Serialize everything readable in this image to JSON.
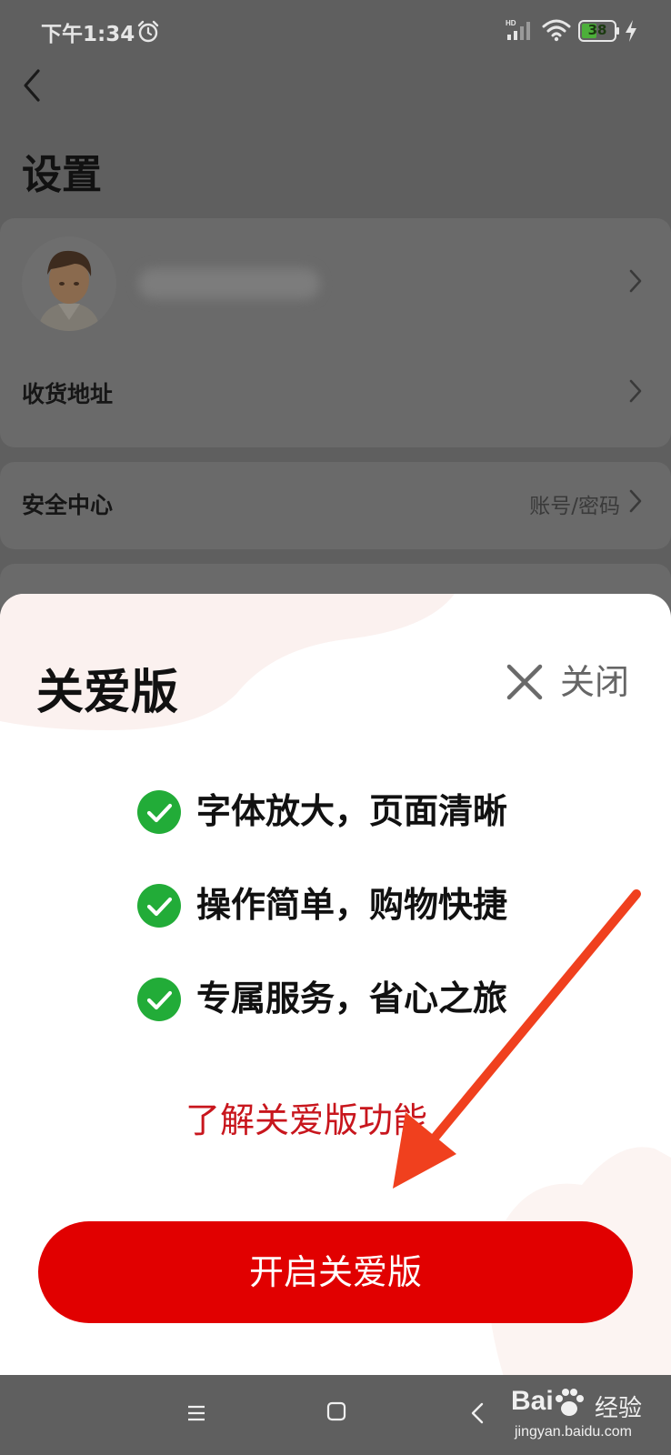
{
  "status_bar": {
    "time": "下午1:34",
    "battery": "38"
  },
  "settings": {
    "title": "设置",
    "rows": [
      {
        "label": "收货地址",
        "value": ""
      },
      {
        "label": "安全中心",
        "value": "账号/密码"
      }
    ]
  },
  "sheet": {
    "title": "关爱版",
    "close_label": "关闭",
    "features": [
      "字体放大，页面清晰",
      "操作简单，购物快捷",
      "专属服务，省心之旅"
    ],
    "learn_more": "了解关爱版功能",
    "enable_button": "开启关爱版"
  },
  "watermark": {
    "logo": "Bai",
    "cn": "经验",
    "url": "jingyan.baidu.com"
  },
  "colors": {
    "accent_red": "#e10000",
    "link_red": "#c8161d",
    "check_green": "#22ac38",
    "arrow_red": "#f0401e"
  }
}
